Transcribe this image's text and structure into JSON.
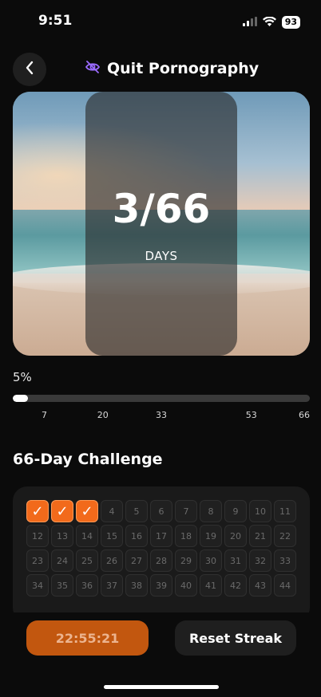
{
  "status_bar": {
    "time": "9:51",
    "battery": "93",
    "icons": [
      "signal-icon",
      "wifi-icon",
      "battery-icon"
    ]
  },
  "header": {
    "title": "Quit Pornography",
    "back_icon": "chevron-left-icon",
    "title_icon": "eye-off-icon",
    "accent_color": "#9b6bff"
  },
  "hero": {
    "count": "3/66",
    "unit": "DAYS"
  },
  "progress": {
    "label": "5%",
    "fraction": 0.05,
    "milestones": [
      "7",
      "20",
      "33",
      "53",
      "66"
    ]
  },
  "challenge": {
    "title": "66-Day Challenge",
    "done_days": [
      1,
      2,
      3
    ],
    "done_mark": "✓",
    "visible_days": [
      4,
      5,
      6,
      7,
      8,
      9,
      10,
      11,
      12,
      13,
      14,
      15,
      16,
      17,
      18,
      19,
      20,
      21,
      22,
      23,
      24,
      25,
      26,
      27,
      28,
      29,
      30,
      31,
      32,
      33,
      34,
      35,
      36,
      37,
      38,
      39,
      40,
      41,
      42,
      43,
      44
    ]
  },
  "actions": {
    "timer": "22:55:21",
    "reset": "Reset Streak"
  },
  "colors": {
    "accent": "#f26a1b",
    "timer_bg": "#c2570f",
    "background": "#0b0b0b"
  }
}
